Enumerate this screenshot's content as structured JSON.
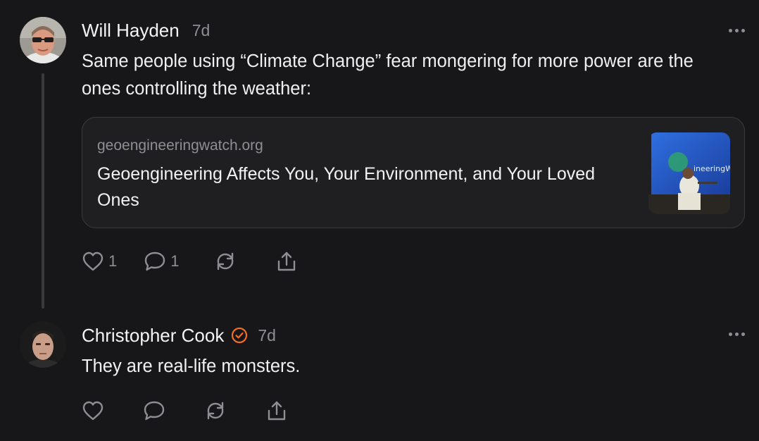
{
  "posts": [
    {
      "author": "Will Hayden",
      "timestamp": "7d",
      "avatar_icon": "user-avatar",
      "text": "Same people using “Climate Change” fear mongering for more power are the ones controlling the weather:",
      "link_card": {
        "domain": "geoengineeringwatch.org",
        "title": "Geoengineering Affects You, Your Environment, and Your Loved Ones",
        "thumb_text": "ineeringW"
      },
      "like_count": "1",
      "reply_count": "1"
    },
    {
      "author": "Christopher Cook",
      "timestamp": "7d",
      "verified": true,
      "avatar_icon": "user-avatar",
      "text": "They are real-life monsters.",
      "like_count": "",
      "reply_count": ""
    }
  ],
  "colors": {
    "background": "#171719",
    "text": "#f2f2f2",
    "muted": "#8e8e93",
    "verified_badge": "#f26f21",
    "card_border": "#3b3b3e"
  }
}
